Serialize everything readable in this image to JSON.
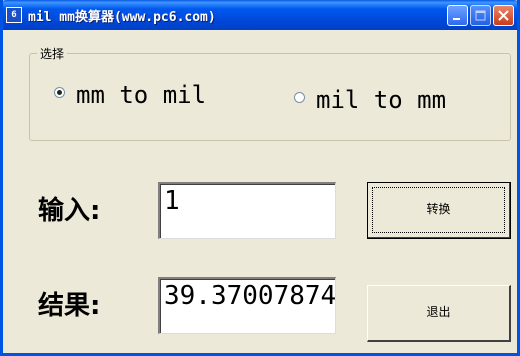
{
  "window": {
    "title": "mil mm换算器(www.pc6.com)",
    "icon": "pc6-app-icon",
    "icon_text": "6"
  },
  "group": {
    "label": "选择",
    "options": [
      {
        "label": "mm to mil",
        "checked": true
      },
      {
        "label": "mil to mm",
        "checked": false
      }
    ]
  },
  "input": {
    "label": "输入:",
    "value": "1"
  },
  "result": {
    "label": "结果:",
    "value": "39.37007874"
  },
  "buttons": {
    "convert": "转换",
    "exit": "退出"
  },
  "colors": {
    "titlebar": "#0058EE",
    "window_bg": "#ECE9D8",
    "close": "#C73D1B"
  }
}
